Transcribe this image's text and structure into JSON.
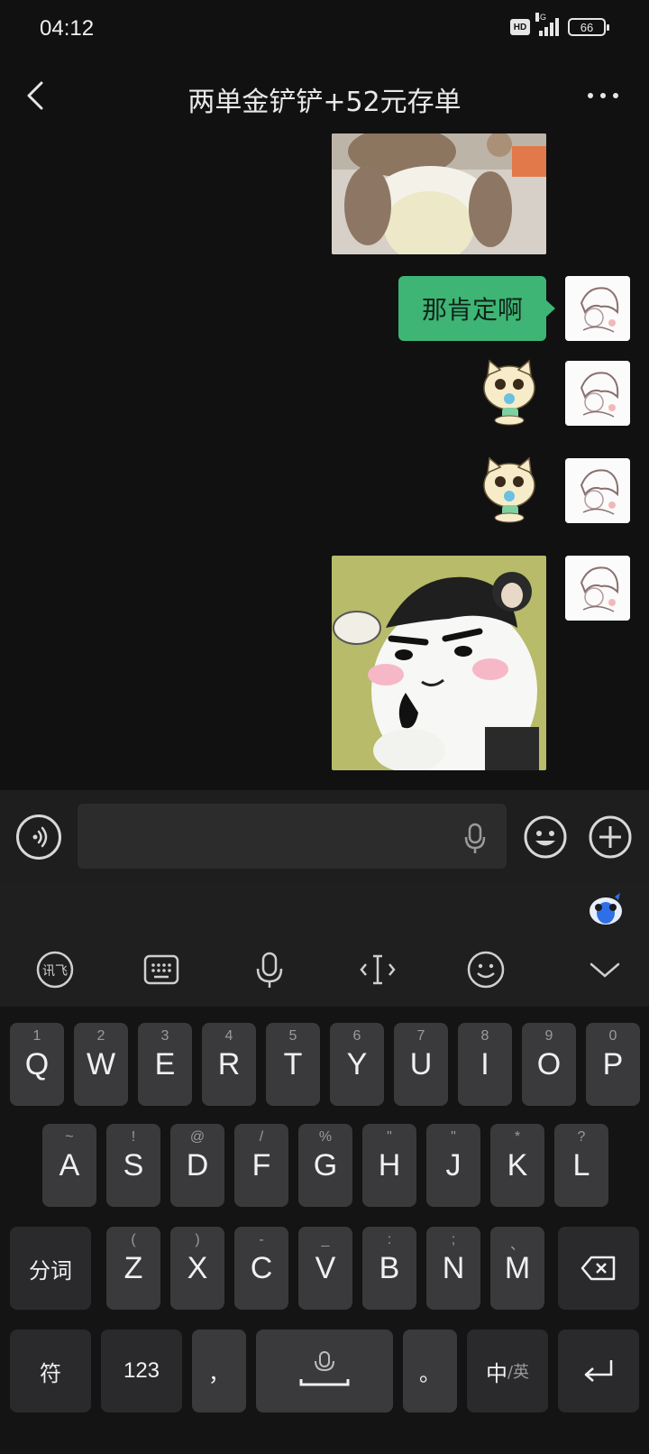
{
  "status_bar": {
    "time": "04:12",
    "hd_label": "HD",
    "network_label": "4G",
    "battery_level": "66"
  },
  "header": {
    "title": "两单金铲铲+52元存单",
    "back_icon": "chevron-left-icon",
    "more_icon": "more-horizontal-icon"
  },
  "chat": {
    "messages": [
      {
        "type": "image",
        "content": "plush-toy-photo",
        "sender": "me"
      },
      {
        "type": "text",
        "text": "那肯定啊",
        "sender": "me"
      },
      {
        "type": "sticker",
        "content": "cat-sticker",
        "sender": "me"
      },
      {
        "type": "sticker",
        "content": "cat-sticker",
        "sender": "me"
      },
      {
        "type": "image",
        "content": "cow-thinking-sticker",
        "sender": "me"
      }
    ],
    "bubble_color": "#3eb575"
  },
  "input_bar": {
    "voice_icon": "voice-icon",
    "field_value": "",
    "mic_icon": "mic-icon",
    "emoji_icon": "emoji-icon",
    "plus_icon": "plus-circle-icon"
  },
  "keyboard": {
    "toolbar": [
      "ifly-icon",
      "keyboard-icon",
      "mic-icon",
      "cursor-icon",
      "emoji-icon",
      "collapse-icon"
    ],
    "row1": [
      {
        "main": "Q",
        "sub": "1"
      },
      {
        "main": "W",
        "sub": "2"
      },
      {
        "main": "E",
        "sub": "3"
      },
      {
        "main": "R",
        "sub": "4"
      },
      {
        "main": "T",
        "sub": "5"
      },
      {
        "main": "Y",
        "sub": "6"
      },
      {
        "main": "U",
        "sub": "7"
      },
      {
        "main": "I",
        "sub": "8"
      },
      {
        "main": "O",
        "sub": "9"
      },
      {
        "main": "P",
        "sub": "0"
      }
    ],
    "row2": [
      {
        "main": "A",
        "sub": "~"
      },
      {
        "main": "S",
        "sub": "!"
      },
      {
        "main": "D",
        "sub": "@"
      },
      {
        "main": "F",
        "sub": "/"
      },
      {
        "main": "G",
        "sub": "%"
      },
      {
        "main": "H",
        "sub": "\""
      },
      {
        "main": "J",
        "sub": "\""
      },
      {
        "main": "K",
        "sub": "*"
      },
      {
        "main": "L",
        "sub": "?"
      }
    ],
    "row3": [
      {
        "main": "Z",
        "sub": "("
      },
      {
        "main": "X",
        "sub": ")"
      },
      {
        "main": "C",
        "sub": "-"
      },
      {
        "main": "V",
        "sub": "_"
      },
      {
        "main": "B",
        "sub": ":"
      },
      {
        "main": "N",
        "sub": ";"
      },
      {
        "main": "M",
        "sub": "、"
      }
    ],
    "segment_key": "分词",
    "symbol_key": "符",
    "num_key": "123",
    "comma_key": "，",
    "period_key": "。",
    "lang_zh": "中",
    "lang_en": "/英"
  }
}
